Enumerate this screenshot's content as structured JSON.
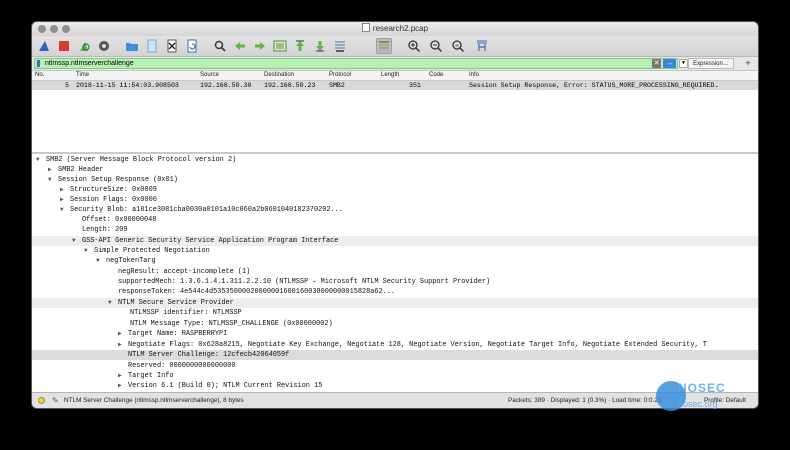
{
  "window": {
    "title": "research2.pcap"
  },
  "toolbar": {
    "icons": [
      "shark-fin-start-icon",
      "stop-square-icon",
      "restart-capture-icon",
      "capture-options-icon",
      "open-folder-icon",
      "open-file-icon",
      "close-file-icon",
      "reload-icon",
      "search-icon",
      "go-back-icon",
      "go-forward-icon",
      "go-to-packet-icon",
      "go-first-icon",
      "go-last-icon",
      "autoscroll-icon",
      "colorize-icon",
      "zoom-in-icon",
      "zoom-out-icon",
      "zoom-normal-icon",
      "resize-columns-icon"
    ]
  },
  "filter": {
    "value": "ntlmssp.ntlmserverchallenge",
    "expression_label": "Expression…",
    "plus_label": "+"
  },
  "packet_list": {
    "columns": [
      "No.",
      "Time",
      "Source",
      "Destination",
      "Protocol",
      "Length",
      "Code",
      "Info"
    ],
    "rows": [
      {
        "no": "5",
        "time": "2018-11-15 11:54:03.908503",
        "source": "192.168.50.30",
        "destination": "192.168.50.23",
        "protocol": "SMB2",
        "length": "351",
        "code": "",
        "info": "Session Setup Response, Error: STATUS_MORE_PROCESSING_REQUIRED…"
      }
    ]
  },
  "details": {
    "lines": [
      {
        "arrow": "▼",
        "text": "SMB2 (Server Message Block Protocol version 2)"
      },
      {
        "arrow": "▶",
        "text": "SMB2 Header"
      },
      {
        "arrow": "▼",
        "text": "Session Setup Response (0x01)"
      },
      {
        "arrow": "▶",
        "text": "StructureSize: 0x0009"
      },
      {
        "arrow": "▶",
        "text": "Session Flags: 0x0000"
      },
      {
        "arrow": "▼",
        "text": "Security Blob: a181ce3081cba0030a0101a10c060a2b0601040182370202..."
      },
      {
        "arrow": "",
        "text": "Offset: 0x00000048"
      },
      {
        "arrow": "",
        "text": "Length: 209"
      },
      {
        "arrow": "▼",
        "text": "GSS-API Generic Security Service Application Program Interface"
      },
      {
        "arrow": "▼",
        "text": "Simple Protected Negotiation"
      },
      {
        "arrow": "▼",
        "text": "negTokenTarg"
      },
      {
        "arrow": "",
        "text": "negResult: accept-incomplete (1)"
      },
      {
        "arrow": "",
        "text": "supportedMech: 1.3.6.1.4.1.311.2.2.10 (NTLMSSP – Microsoft NTLM Security Support Provider)"
      },
      {
        "arrow": "",
        "text": "responseToken: 4e544c4d53535000020000001600160038000000015828a62..."
      },
      {
        "arrow": "▼",
        "text": "NTLM Secure Service Provider"
      },
      {
        "arrow": "",
        "text": "NTLMSSP identifier: NTLMSSP"
      },
      {
        "arrow": "",
        "text": "NTLM Message Type: NTLMSSP_CHALLENGE (0x00000002)"
      },
      {
        "arrow": "▶",
        "text": "Target Name: RASPBERRYPI"
      },
      {
        "arrow": "▶",
        "text": "Negotiate Flags: 0x628a8215, Negotiate Key Exchange, Negotiate 128, Negotiate Version, Negotiate Target Info, Negotiate Extended Security, T"
      },
      {
        "arrow": "",
        "text": "NTLM Server Challenge: 12cfecb42064059f"
      },
      {
        "arrow": "",
        "text": "Reserved: 0000000000000000"
      },
      {
        "arrow": "▶",
        "text": "Target Info"
      },
      {
        "arrow": "▶",
        "text": "Version 6.1 (Build 0); NTLM Current Revision 15"
      }
    ]
  },
  "status": {
    "message": "NTLM Server Challenge (ntlmssp.ntlmserverchallenge), 8 bytes",
    "packets": "Packets: 389 · Displayed: 1 (0.3%) · Load time: 0:0.23",
    "profile": "Profile: Default"
  },
  "watermark": {
    "title": "NOSEC",
    "subtitle": "nosec.org"
  }
}
